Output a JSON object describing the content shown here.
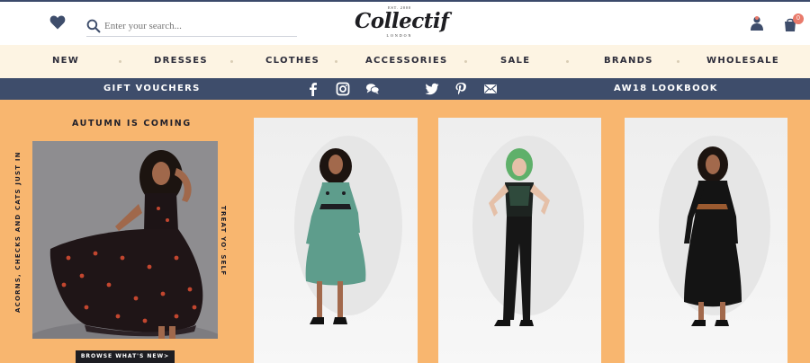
{
  "header": {
    "search": {
      "placeholder": "Enter your search..."
    },
    "logo": {
      "est": "EST. 2000",
      "word": "Collectif",
      "sub": "LONDON"
    },
    "cart_count": "0",
    "icons": [
      "heart-icon",
      "search-icon",
      "user-icon",
      "cart-icon"
    ]
  },
  "nav": {
    "items": [
      "NEW",
      "DRESSES",
      "CLOTHES",
      "ACCESSORIES",
      "SALE",
      "BRANDS",
      "WHOLESALE"
    ]
  },
  "promo": {
    "gift_vouchers": "GIFT VOUCHERS",
    "lookbook": "AW18 LOOKBOOK",
    "social_icons": [
      "facebook-icon",
      "instagram-icon",
      "chat-icon",
      "twitter-icon",
      "pinterest-icon",
      "mail-icon"
    ]
  },
  "feature": {
    "title": "AUTUMN IS COMING",
    "side_left": "ACORNS, CHECKS AND CATS JUST IN",
    "side_right": "TREAT YO' SELF",
    "browse": "BROWSE WHAT'S NEW>"
  },
  "colors": {
    "navy": "#3e4d6b",
    "cream": "#fdf4e3",
    "orange": "#f8b66f",
    "teal_dress": "#5e9d8c",
    "badge": "#e97a6b"
  }
}
